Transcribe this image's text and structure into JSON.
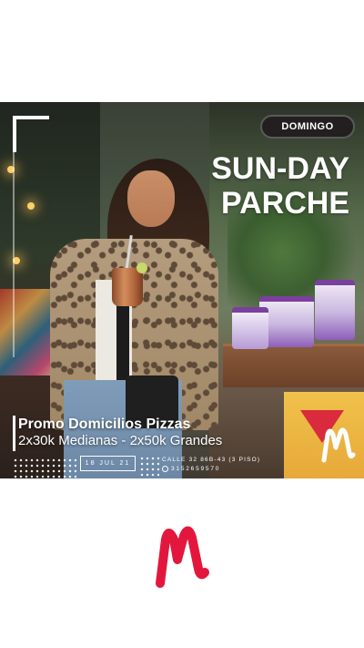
{
  "post": {
    "day_badge": "DOMINGO",
    "event_title_lines": [
      "SUN-DAY",
      "PARCHE"
    ],
    "promo_heading": "Promo Domicilios Pizzas",
    "promo_sub": "2x30k Medianas - 2x50k Grandes",
    "date": "18 JUL 21",
    "address": "CALLE 32 86B-43 (3 PISO)",
    "phone": "3152659570",
    "phone_icon": "whatsapp-icon",
    "colors": {
      "badge_bg": "#231f20",
      "text": "#ffffff",
      "brand_red": "#e3173e"
    }
  },
  "brand": {
    "logo_icon": "m-logo-icon",
    "logo_color": "#e3173e"
  }
}
